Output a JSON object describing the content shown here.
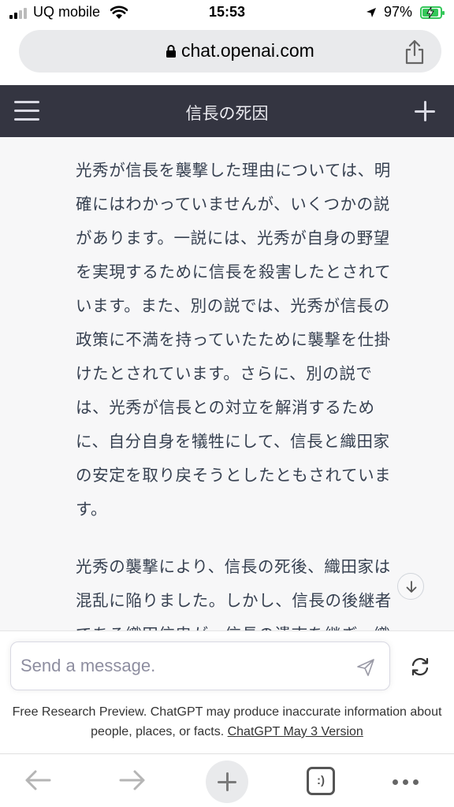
{
  "status_bar": {
    "carrier": "UQ mobile",
    "time": "15:53",
    "battery": "97%"
  },
  "browser": {
    "url": "chat.openai.com"
  },
  "header": {
    "title": "信長の死因"
  },
  "chat": {
    "paragraph1_lines": [
      "光秀が信長を襲撃した理由については、明",
      "確にはわかっていませんが、いくつかの説",
      "があります。一説には、光秀が自身の野望",
      "を実現するために信長を殺害したとされて",
      "います。また、別の説では、光秀が信長の",
      "政策に不満を持っていたために襲撃を仕掛",
      "けたとされています。さらに、別の説で",
      "は、光秀が信長との対立を解消するため",
      "に、自分自身を犠牲にして、信長と織田家",
      "の安定を取り戻そうとしたともされていま",
      "す。"
    ],
    "paragraph2_lines": [
      "光秀の襲撃により、信長の死後、織田家は",
      "混乱に陥りました。しかし、信長の後継者",
      "である織田信忠が、信長の遺志を継ぎ、織"
    ]
  },
  "composer": {
    "placeholder": "Send a message.",
    "value": ""
  },
  "disclaimer": {
    "text": "Free Research Preview. ChatGPT may produce inaccurate information about people, places, or facts.",
    "link": "ChatGPT May 3 Version"
  },
  "toolbar": {
    "tabs_label": ":)"
  },
  "colors": {
    "header_bg": "#343541",
    "content_bg": "#f7f7f8",
    "battery_green": "#34c759"
  }
}
